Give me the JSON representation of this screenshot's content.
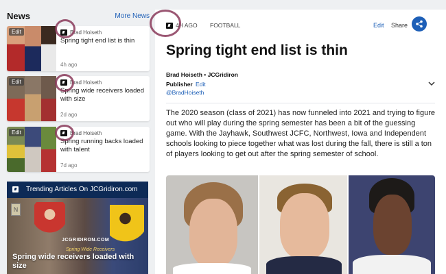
{
  "sidebar": {
    "title": "News",
    "more_link": "More News",
    "cards": [
      {
        "edit": "Edit",
        "author": "Brad Hoiseth",
        "title": "Spring tight end list is thin",
        "time": "4h ago"
      },
      {
        "edit": "Edit",
        "author": "Brad Hoiseth",
        "title": "Spring wide receivers loaded with size",
        "time": "2d ago"
      },
      {
        "edit": "Edit",
        "author": "Brad Hoiseth",
        "title": "Spring running backs loaded with talent",
        "time": "7d ago"
      }
    ],
    "trending": {
      "label": "Trending Articles On JCGridiron.com",
      "image_logo": "JCGRIDIRON.COM",
      "image_sub": "Spring Wide Receivers",
      "headline": "Spring wide receivers loaded with size",
      "badge": "N"
    }
  },
  "article": {
    "time": "4H AGO",
    "category": "FOOTBALL",
    "actions": {
      "edit": "Edit",
      "share": "Share"
    },
    "headline": "Spring tight end list is thin",
    "byline": "Brad Hoiseth • JCGridiron",
    "role": "Publisher",
    "role_edit": "Edit",
    "handle": "@BradHoiseth",
    "body": "The 2020 season (class of 2021) has now funneled into 2021 and trying to figure out who will play during the spring semester has been a bit of the guessing game. With the Jayhawk, Southwest JCFC, Northwest, Iowa and Independent schools looking to piece together what was lost during the fall, there is still a ton of players looking to get out after the spring semester of school."
  },
  "colors": {
    "accent": "#1d5fb7",
    "trending_bg": "#0d2a56",
    "annotation": "#8a3a5a"
  },
  "icons": [
    "brand-icon",
    "share-icon",
    "chevron-down-icon"
  ]
}
